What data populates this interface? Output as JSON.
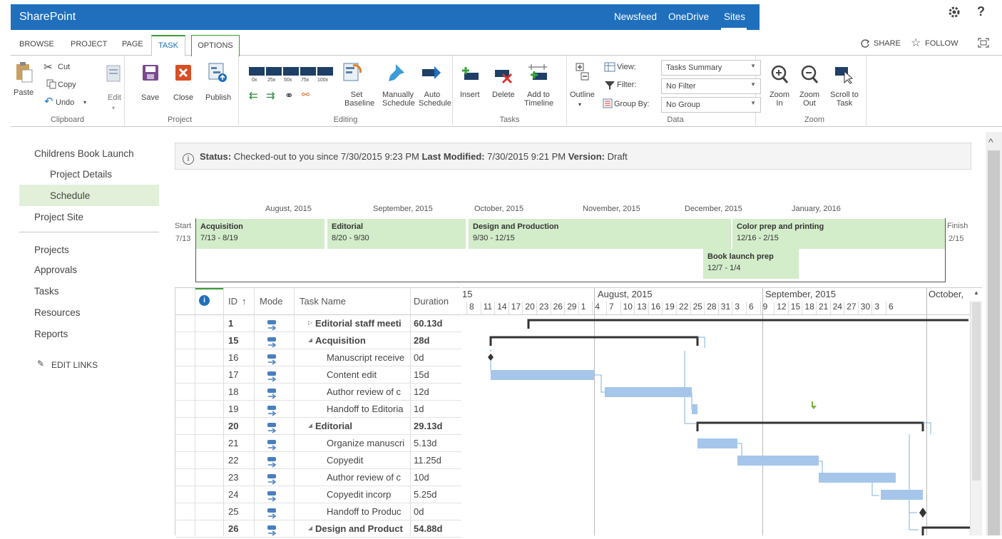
{
  "app": {
    "brand": "SharePoint",
    "nav": [
      "Newsfeed",
      "OneDrive",
      "Sites"
    ],
    "help": "?"
  },
  "tabs": {
    "browse": "BROWSE",
    "project": "PROJECT",
    "page": "PAGE",
    "task": "TASK",
    "options": "OPTIONS",
    "share": "SHARE",
    "follow": "FOLLOW"
  },
  "ribbon": {
    "clipboard": {
      "group": "Clipboard",
      "paste": "Paste",
      "cut": "Cut",
      "copy": "Copy",
      "undo": "Undo"
    },
    "project": {
      "group": "Project",
      "edit": "Edit",
      "save": "Save",
      "close": "Close",
      "publish": "Publish"
    },
    "editing": {
      "group": "Editing",
      "pct": [
        "0x",
        "25x",
        "50x",
        "75x",
        "100x"
      ],
      "set_baseline": "Set Baseline",
      "manually": "Manually Schedule",
      "auto": "Auto Schedule"
    },
    "tasks": {
      "group": "Tasks",
      "insert": "Insert",
      "delete": "Delete",
      "add_timeline": "Add to Timeline"
    },
    "data": {
      "group": "Data",
      "outline": "Outline",
      "view_label": "View:",
      "view_value": "Tasks Summary",
      "filter_label": "Filter:",
      "filter_value": "No Filter",
      "group_label": "Group By:",
      "group_value": "No Group"
    },
    "zoom": {
      "group": "Zoom",
      "zoom_in": "Zoom In",
      "zoom_out": "Zoom Out",
      "scroll_to_task": "Scroll to Task"
    }
  },
  "leftnav": {
    "items": [
      "Childrens Book Launch",
      "Project Details",
      "Schedule",
      "Project Site",
      "Projects",
      "Approvals",
      "Tasks",
      "Resources",
      "Reports"
    ],
    "edit_links": "EDIT LINKS"
  },
  "status": {
    "label1": "Status:",
    "text1": "Checked-out to you since 7/30/2015 9:23 PM",
    "label2": "Last Modified:",
    "text2": "7/30/2015 9:21 PM",
    "label3": "Version:",
    "text3": "Draft"
  },
  "timeline": {
    "months": [
      "August, 2015",
      "September, 2015",
      "October, 2015",
      "November, 2015",
      "December, 2015",
      "January, 2016"
    ],
    "start_label": "Start",
    "start_date": "7/13",
    "finish_label": "Finish",
    "finish_date": "2/15",
    "bars": [
      {
        "name": "Acquisition",
        "dates": "7/13 - 8/19"
      },
      {
        "name": "Editorial",
        "dates": "8/20 - 9/30"
      },
      {
        "name": "Design and Production",
        "dates": "9/30 - 12/15"
      },
      {
        "name": "Color prep and printing",
        "dates": "12/16 - 2/15"
      },
      {
        "name": "Book launch prep",
        "dates": "12/7 - 1/4"
      }
    ]
  },
  "grid": {
    "headers": {
      "id": "ID",
      "sort": "↑",
      "mode": "Mode",
      "name": "Task Name",
      "duration": "Duration"
    },
    "rows": [
      {
        "id": "1",
        "name": "Editorial staff meeti",
        "duration": "60.13d",
        "bold": true,
        "type": "collapsed"
      },
      {
        "id": "15",
        "name": "Acquisition",
        "duration": "28d",
        "bold": true,
        "type": "expanded"
      },
      {
        "id": "16",
        "name": "Manuscript receive",
        "duration": "0d",
        "bold": false,
        "type": "child"
      },
      {
        "id": "17",
        "name": "Content edit",
        "duration": "15d",
        "bold": false,
        "type": "child"
      },
      {
        "id": "18",
        "name": "Author review of c",
        "duration": "12d",
        "bold": false,
        "type": "child"
      },
      {
        "id": "19",
        "name": "Handoff to Editoria",
        "duration": "1d",
        "bold": false,
        "type": "child"
      },
      {
        "id": "20",
        "name": "Editorial",
        "duration": "29.13d",
        "bold": true,
        "type": "expanded"
      },
      {
        "id": "21",
        "name": "Organize manuscri",
        "duration": "5.13d",
        "bold": false,
        "type": "child"
      },
      {
        "id": "22",
        "name": "Copyedit",
        "duration": "11.25d",
        "bold": false,
        "type": "child"
      },
      {
        "id": "23",
        "name": "Author review of c",
        "duration": "10d",
        "bold": false,
        "type": "child"
      },
      {
        "id": "24",
        "name": "Copyedit incorp",
        "duration": "5.25d",
        "bold": false,
        "type": "child"
      },
      {
        "id": "25",
        "name": "Handoff to Produc",
        "duration": "0d",
        "bold": false,
        "type": "child"
      },
      {
        "id": "26",
        "name": "Design and Product",
        "duration": "54.88d",
        "bold": true,
        "type": "expanded"
      }
    ]
  },
  "gantt": {
    "months": [
      "15",
      "August, 2015",
      "September, 2015",
      "October,"
    ],
    "days": [
      "8",
      "11",
      "14",
      "17",
      "20",
      "23",
      "26",
      "29",
      "1",
      "4",
      "7",
      "10",
      "13",
      "16",
      "19",
      "22",
      "25",
      "28",
      "31",
      "3",
      "6",
      "9",
      "12",
      "15",
      "18",
      "21",
      "24",
      "27",
      "30",
      "3",
      "6"
    ]
  },
  "colors": {
    "suite_blue": "#1f6fbd",
    "timeline_green": "#d3ecca",
    "gantt_bar": "#a5c6ea"
  }
}
